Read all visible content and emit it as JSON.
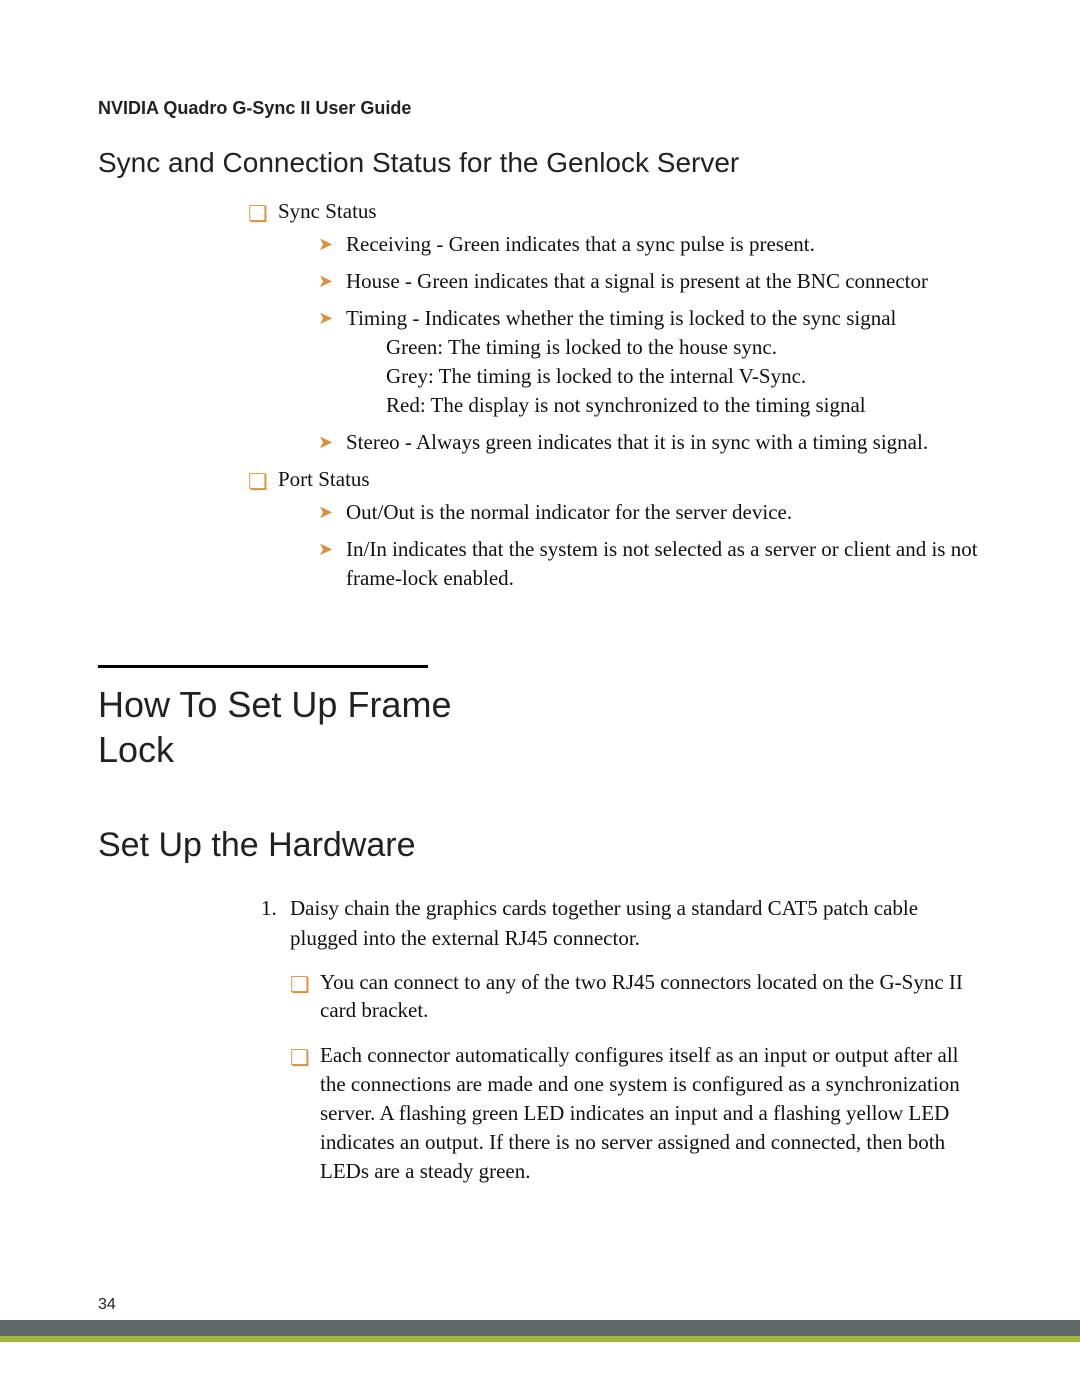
{
  "header": {
    "running_title": "NVIDIA Quadro G-Sync II User Guide"
  },
  "section_status": {
    "title": "Sync and Connection Status for the Genlock Server",
    "sync_status": {
      "label": "Sync Status",
      "items": {
        "receiving": "Receiving  - Green indicates that a sync pulse is present.",
        "house": "House  - Green indicates that a signal is present at the BNC connector",
        "timing_head": "Timing - Indicates whether the timing is locked to the sync signal",
        "timing_green": "Green: The timing is locked to the house sync.",
        "timing_grey": "Grey: The timing is locked to the internal V-Sync.",
        "timing_red": "Red: The display is not synchronized to the timing signal",
        "stereo": "Stereo - Always green indicates that it is in sync with a timing signal."
      }
    },
    "port_status": {
      "label": "Port Status",
      "items": {
        "outout": "Out/Out is the normal indicator for the server device.",
        "inin": "In/In indicates that the system is not selected as a server or client and is not frame-lock enabled."
      }
    }
  },
  "section_framelock": {
    "title_line1": "How To Set Up Frame",
    "title_line2": "Lock"
  },
  "section_hardware": {
    "title": "Set Up the Hardware",
    "step1": {
      "text": "Daisy chain the graphics cards together using a standard CAT5 patch cable plugged into the external RJ45 connector.",
      "sub": {
        "a": "You can connect to any of the two RJ45 connectors located on the G-Sync II card bracket.",
        "b": "Each connector automatically configures itself as an input or output after all the connections are made and one system is configured as a synchronization server. A flashing green LED indicates an input and a flashing yellow LED indicates an output. If there is no server assigned and connected, then both LEDs are a steady green."
      }
    }
  },
  "footer": {
    "page_number": "34"
  },
  "bullets": {
    "hollow_square": "❏"
  }
}
